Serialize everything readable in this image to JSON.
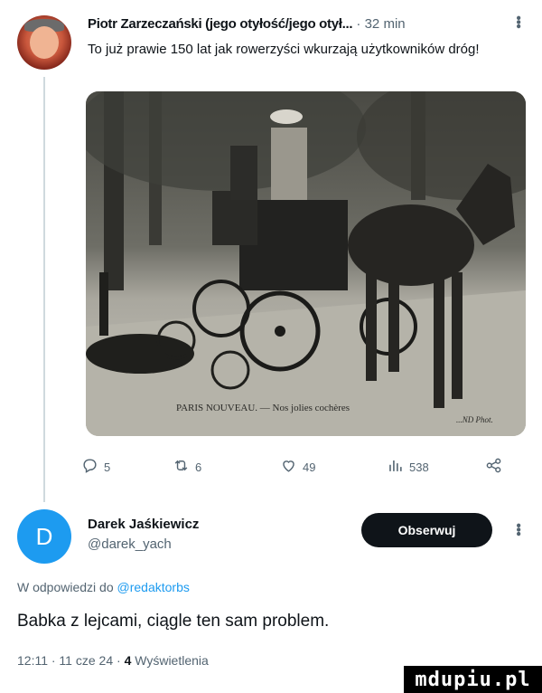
{
  "post": {
    "author_name": "Piotr Zarzeczański (jego otyłość/jego otył...",
    "separator": "·",
    "time": "32 min",
    "text": "To już prawie 150 lat jak rowerzyści wkurzają użytkowników dróg!",
    "image": {
      "caption": "PARIS NOUVEAU. — Nos jolies cochères",
      "caption_small": "...ND Phot."
    },
    "actions": {
      "replies": "5",
      "reposts": "6",
      "likes": "49",
      "views": "538"
    }
  },
  "reply": {
    "avatar_letter": "D",
    "author_name": "Darek Jaśkiewicz",
    "handle": "@darek_yach",
    "follow_label": "Obserwuj",
    "reply_prefix": "W odpowiedzi do",
    "reply_mention": "@redaktorbs",
    "text": "Babka z lejcami, ciągle ten sam problem.",
    "timestamp": "12:11 · 11 cze 24 ·",
    "views_count": "4",
    "views_label": "Wyświetlenia"
  },
  "watermark": "mdupiu.pl",
  "colors": {
    "accent": "#1d9bf0",
    "text": "#0f1419",
    "muted": "#536471",
    "button": "#0f1419"
  },
  "icons": [
    "reply-icon",
    "repost-icon",
    "like-icon",
    "views-icon",
    "share-icon",
    "more-icon"
  ]
}
